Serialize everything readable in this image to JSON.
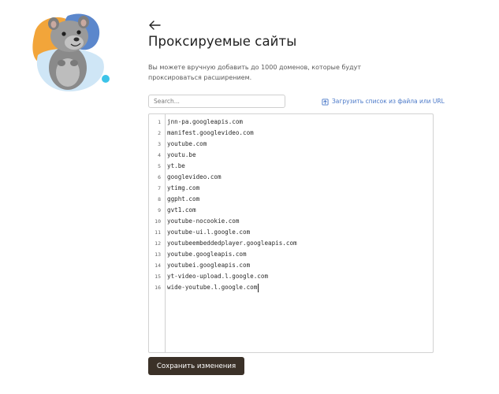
{
  "header": {
    "back_icon": "arrow-left-icon",
    "title": "Проксируемые сайты",
    "description": "Вы можете вручную добавить до 1000 доменов, которые будут проксироваться расширением."
  },
  "search": {
    "placeholder": "Search..."
  },
  "upload": {
    "icon": "upload-file-icon",
    "label": "Загрузить список из файла или URL"
  },
  "editor": {
    "lines": [
      {
        "num": "1",
        "text": "jnn-pa.googleapis.com"
      },
      {
        "num": "2",
        "text": "manifest.googlevideo.com"
      },
      {
        "num": "3",
        "text": "youtube.com"
      },
      {
        "num": "4",
        "text": "youtu.be"
      },
      {
        "num": "5",
        "text": "yt.be"
      },
      {
        "num": "6",
        "text": "googlevideo.com"
      },
      {
        "num": "7",
        "text": "ytimg.com"
      },
      {
        "num": "8",
        "text": "ggpht.com"
      },
      {
        "num": "9",
        "text": "gvt1.com"
      },
      {
        "num": "10",
        "text": "youtube-nocookie.com"
      },
      {
        "num": "11",
        "text": "youtube-ui.l.google.com"
      },
      {
        "num": "12",
        "text": "youtubeembeddedplayer.googleapis.com"
      },
      {
        "num": "13",
        "text": "youtube.googleapis.com"
      },
      {
        "num": "14",
        "text": "youtubei.googleapis.com"
      },
      {
        "num": "15",
        "text": "yt-video-upload.l.google.com"
      },
      {
        "num": "16",
        "text": "wide-youtube.l.google.com"
      }
    ]
  },
  "footer": {
    "save_label": "Сохранить изменения"
  },
  "colors": {
    "accent_link": "#4a78c8",
    "button_bg": "#3b3128",
    "mascot_orange": "#f2a53a",
    "mascot_blue": "#5b87cc",
    "mascot_cyan": "#3cc3e8"
  }
}
